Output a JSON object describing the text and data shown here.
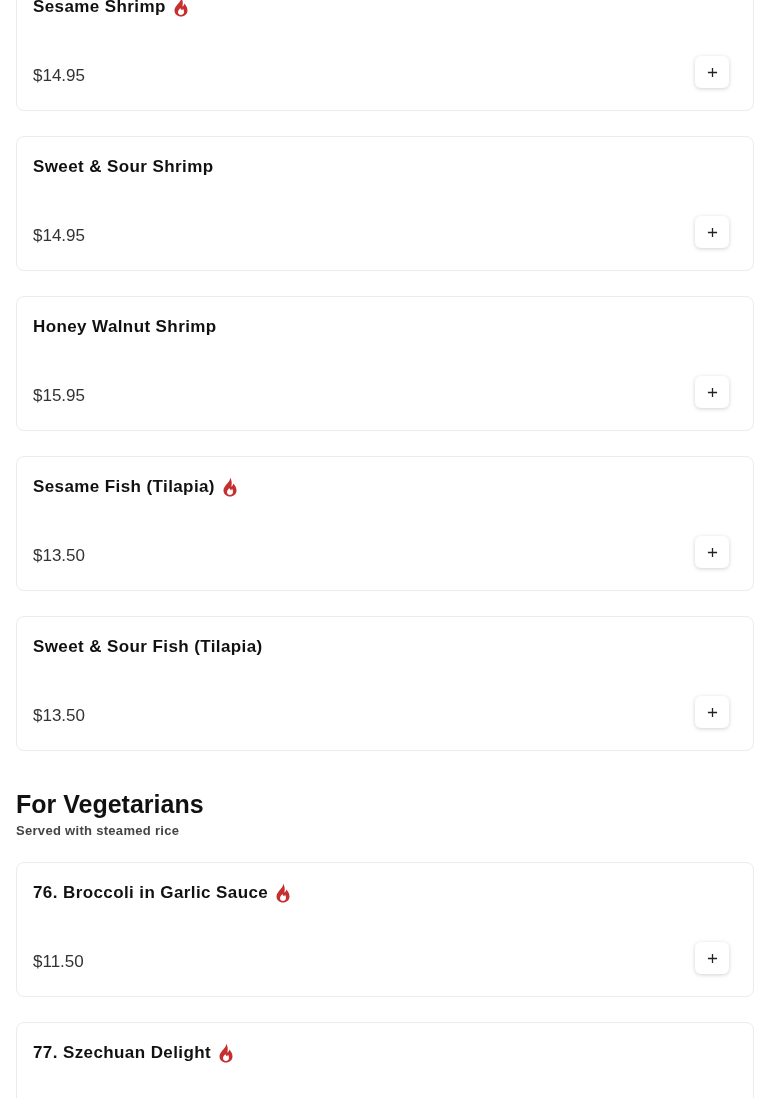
{
  "sections": [
    {
      "items": [
        {
          "name": "Sesame Shrimp",
          "spicy": true,
          "price": "$14.95"
        },
        {
          "name": "Sweet & Sour Shrimp",
          "spicy": false,
          "price": "$14.95"
        },
        {
          "name": "Honey Walnut Shrimp",
          "spicy": false,
          "price": "$15.95"
        },
        {
          "name": "Sesame Fish (Tilapia)",
          "spicy": true,
          "price": "$13.50"
        },
        {
          "name": "Sweet & Sour Fish (Tilapia)",
          "spicy": false,
          "price": "$13.50"
        }
      ]
    },
    {
      "title": "For Vegetarians",
      "subtitle": "Served with steamed rice",
      "items": [
        {
          "name": "76. Broccoli in Garlic Sauce",
          "spicy": true,
          "price": "$11.50"
        },
        {
          "name": "77. Szechuan Delight",
          "spicy": true
        }
      ]
    }
  ]
}
